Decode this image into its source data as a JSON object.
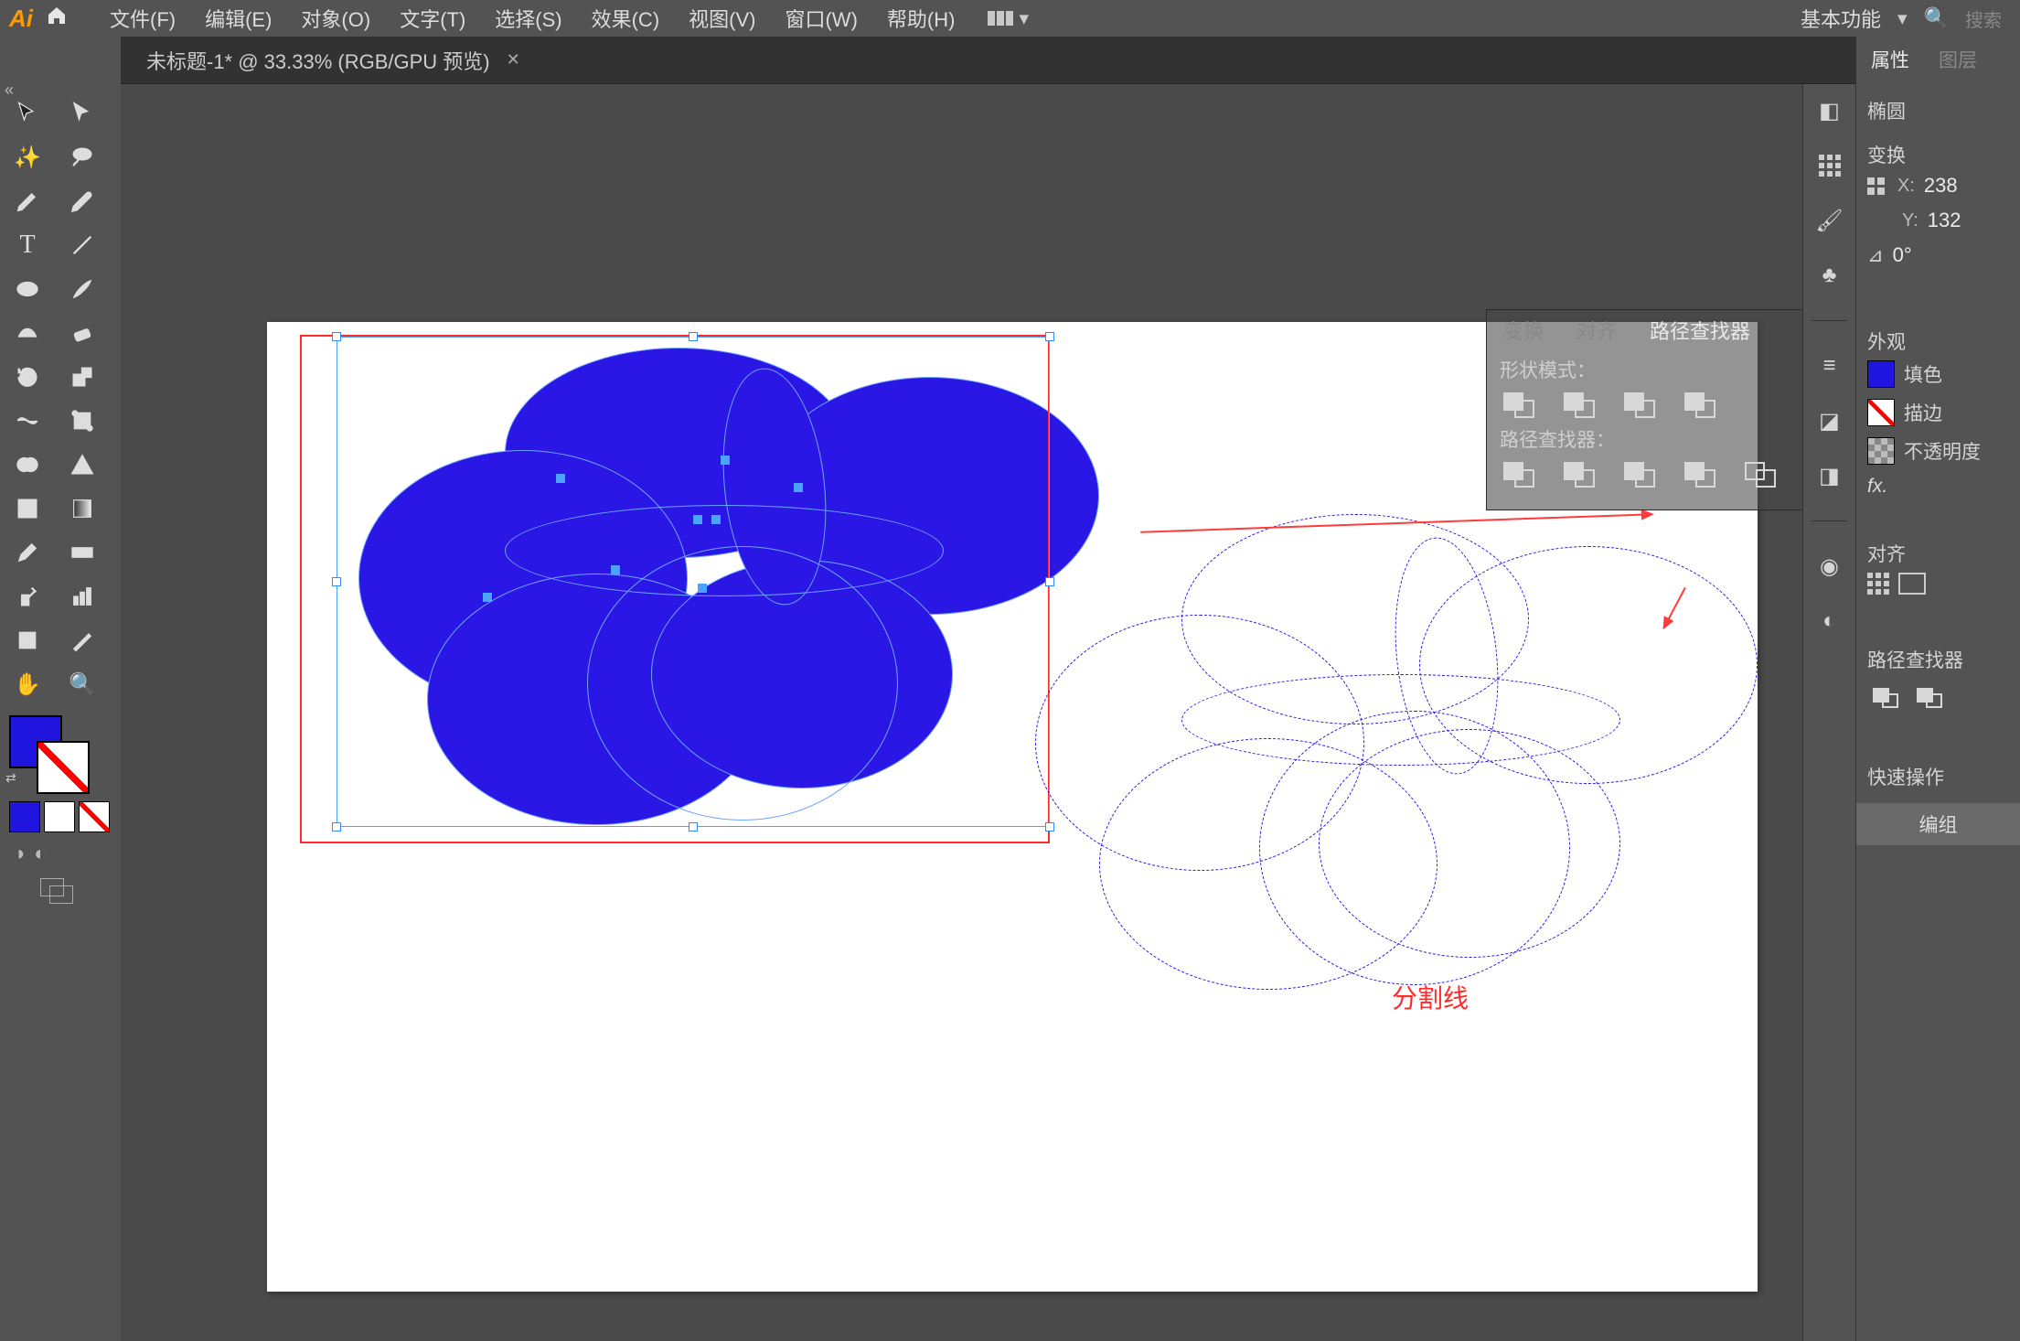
{
  "menubar": {
    "logo": "Ai",
    "items": [
      "文件(F)",
      "编辑(E)",
      "对象(O)",
      "文字(T)",
      "选择(S)",
      "效果(C)",
      "视图(V)",
      "窗口(W)",
      "帮助(H)"
    ],
    "workspace": "基本功能",
    "search_placeholder": "搜索"
  },
  "tab": {
    "title": "未标题-1* @ 33.33% (RGB/GPU 预览)"
  },
  "colors": {
    "fill": "#2015df",
    "shape_blue": "#2a17e6",
    "selection": "#4aa3ff",
    "annotation": "#ff2b2b"
  },
  "pathfinder_panel": {
    "tabs": [
      "变换",
      "对齐",
      "路径查找器"
    ],
    "active_tab": 2,
    "shape_modes_label": "形状模式：",
    "pathfinders_label": "路径查找器："
  },
  "canvas": {
    "annotation_text": "分割线"
  },
  "right": {
    "tabs": [
      "属性",
      "图层"
    ],
    "active_tab": 0,
    "object_type": "椭圆",
    "transform_label": "变换",
    "x_label": "X:",
    "y_label": "Y:",
    "x_val": "238",
    "y_val": "132",
    "angle_prefix": "⊿",
    "angle_val": "0°",
    "appearance_label": "外观",
    "fill_label": "填色",
    "stroke_label": "描边",
    "opacity_label": "不透明度",
    "fx_label": "fx.",
    "align_label": "对齐",
    "pf_label": "路径查找器",
    "quick_label": "快速操作",
    "group_btn": "编组"
  }
}
